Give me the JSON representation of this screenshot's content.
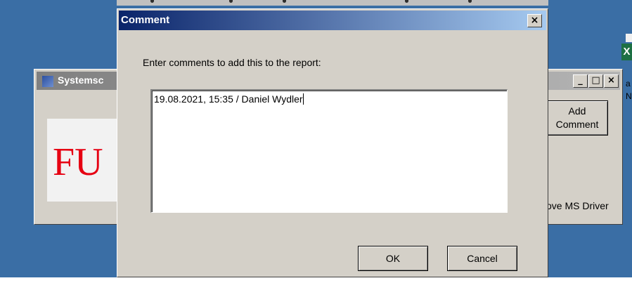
{
  "dialog": {
    "title": "Comment",
    "close_glyph": "×",
    "prompt": "Enter comments to add this to the report:",
    "comment_value": "19.08.2021, 15:35 / Daniel Wydler",
    "ok_label": "OK",
    "cancel_label": "Cancel"
  },
  "background_window": {
    "title": "Systemsc",
    "minimize_glyph": "_",
    "maximize_glyph": "□",
    "close_glyph": "×",
    "logo_text": "FU",
    "add_comment_label": "Add\nComment",
    "driver_text": "ove MS Driver"
  },
  "desktop": {
    "excel_icon_letter": "X",
    "edge_char_a": "a",
    "edge_char_n": "N"
  },
  "colors": {
    "desktop": "#3a6ea5",
    "dialog_title_start": "#0a246a",
    "dialog_title_end": "#a6caf0",
    "window_face": "#d4d0c8",
    "logo_red": "#e60012"
  },
  "icons": [
    "close-icon",
    "minimize-icon",
    "maximize-icon",
    "app-icon",
    "excel-icon"
  ]
}
